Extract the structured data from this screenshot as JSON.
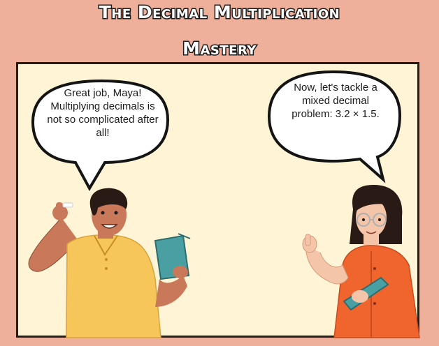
{
  "title": {
    "line1": "The Decimal Multiplication",
    "line2": "Mastery"
  },
  "bubbles": {
    "left": "Great job, Maya! Multiplying decimals is not so complicated after all!",
    "right": "Now, let's tackle a mixed decimal problem: 3.2 × 1.5."
  },
  "colors": {
    "background": "#eeb09a",
    "panel": "#fff5d6",
    "boy_shirt": "#f7c65a",
    "girl_shirt": "#f0652e",
    "book": "#4a9fa2"
  }
}
